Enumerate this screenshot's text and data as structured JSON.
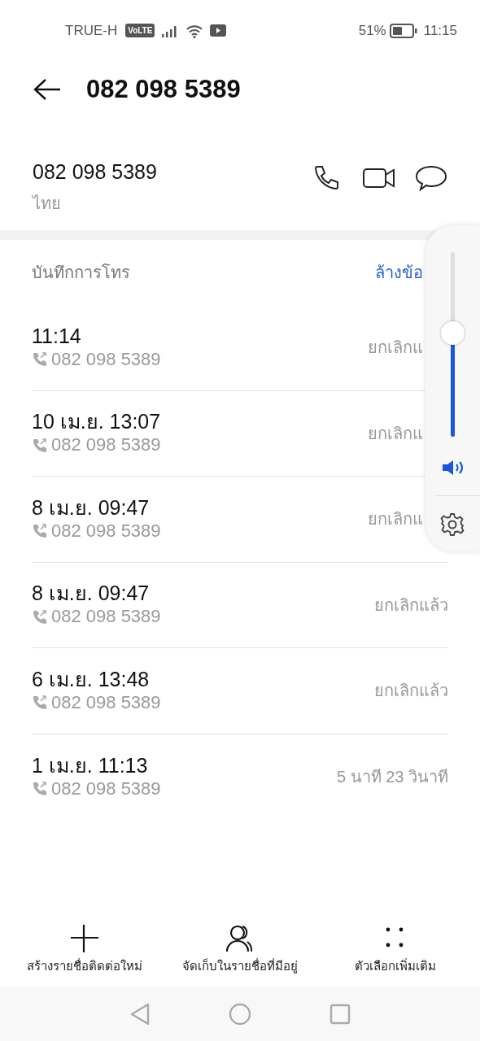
{
  "status_bar": {
    "carrier": "TRUE-H",
    "network_badge": "VoLTE",
    "battery": "51%",
    "time": "11:15"
  },
  "header": {
    "title": "082 098 5389"
  },
  "contact": {
    "number": "082 098 5389",
    "location": "ไทย"
  },
  "call_log": {
    "title": "บันทึกการโทร",
    "clear_action": "ล้างข้อ",
    "entries": [
      {
        "time": "11:14",
        "number": "082 098 5389",
        "status": "ยกเลิกแ"
      },
      {
        "time": "10 เม.ย. 13:07",
        "number": "082 098 5389",
        "status": "ยกเลิกแ"
      },
      {
        "time": "8 เม.ย. 09:47",
        "number": "082 098 5389",
        "status": "ยกเลิกแ"
      },
      {
        "time": "8 เม.ย. 09:47",
        "number": "082 098 5389",
        "status": "ยกเลิกแล้ว"
      },
      {
        "time": "6 เม.ย. 13:48",
        "number": "082 098 5389",
        "status": "ยกเลิกแล้ว"
      },
      {
        "time": "1 เม.ย. 11:13",
        "number": "082 098 5389",
        "status": "5 นาที 23 วินาที"
      }
    ]
  },
  "volume_panel": {
    "level": 0.56
  },
  "actions": [
    {
      "kind": "add",
      "label": "สร้างรายชื่อติดต่อใหม่"
    },
    {
      "kind": "contacts",
      "label": "จัดเก็บในรายชื่อที่มีอยู่"
    },
    {
      "kind": "more",
      "label": "ตัวเลือกเพิ่มเติม"
    }
  ]
}
